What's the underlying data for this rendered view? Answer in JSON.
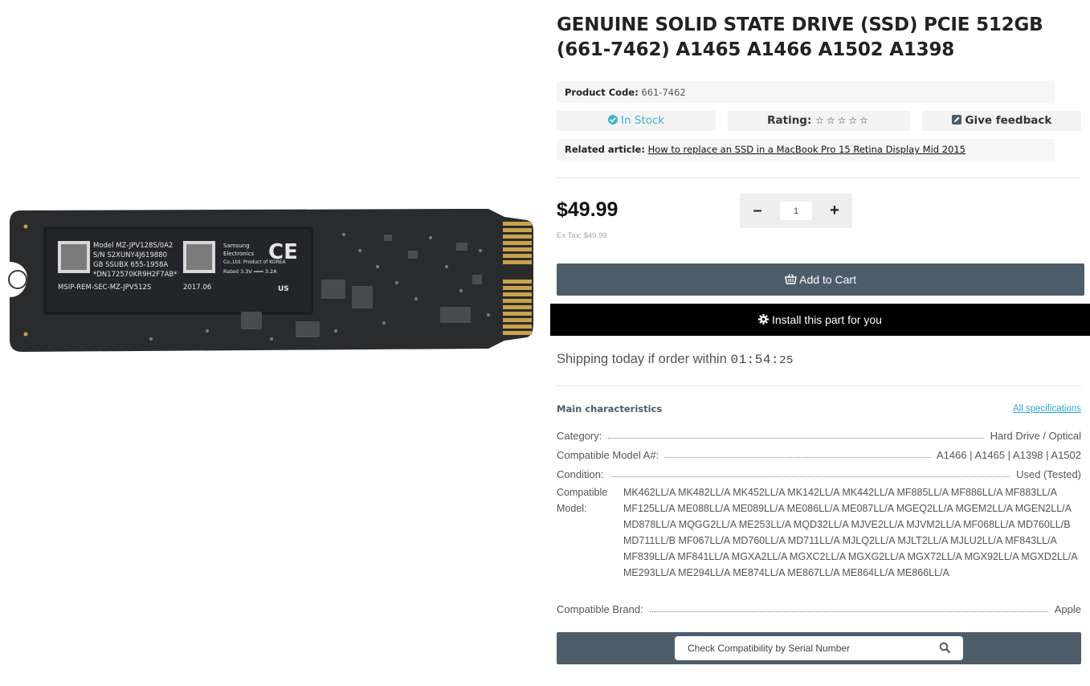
{
  "product": {
    "title": "GENUINE SOLID STATE DRIVE (SSD) PCIE 512GB (661-7462) A1465 A1466 A1502 A1398",
    "code_label": "Product Code:",
    "code_value": "661-7462",
    "stock": "In Stock",
    "rating_label": "Rating:",
    "rating_stars": "☆☆☆☆☆",
    "feedback": "Give feedback",
    "related_label": "Related article:",
    "related_link": "How to replace an SSD in a MacBook Pro 15 Retina Display Mid 2015",
    "price": "$49.99",
    "ex_tax": "Ex Tax: $49.99",
    "qty": "1",
    "qty_minus": "–",
    "qty_plus": "+",
    "add_to_cart": "Add to Cart",
    "install": "Install this part for you",
    "shipping_text": "Shipping today if order within ",
    "timer_h": "01",
    "timer_m": "54",
    "timer_s": "25",
    "timer_sep": ":"
  },
  "image_label": {
    "model": "Model  MZ-JPV128S/0A2",
    "sn": "S/N  S2XUNY4J619880",
    "gb": "GB SSUBX   655-1958A",
    "dn": "*DN172570KR9H2F7AB*",
    "msip": "MSIP-REM-SEC-MZ-JPV512S",
    "date": "2017.06",
    "maker1": "Samsung",
    "maker2": "Electronics",
    "maker3": "Co.,Ltd. Product of KOREA",
    "rated": "Rated 3.3V ═══ 3.2A",
    "ce": "CE",
    "us": "US"
  },
  "specs": {
    "heading": "Main characteristics",
    "all_link": "All specifications",
    "category_k": "Category:",
    "category_v": "Hard Drive / Optical",
    "model_num_k": "Compatible Model A#:",
    "model_num_v": "A1466 | A1465 | A1398 | A1502",
    "condition_k": "Condition:",
    "condition_v": "Used (Tested)",
    "compat_model_k": "Compatible Model:",
    "compat_model_v": "MK462LL/A MK482LL/A MK452LL/A MK142LL/A MK442LL/A MF885LL/A MF886LL/A MF883LL/A MF125LL/A ME088LL/A ME089LL/A ME086LL/A ME087LL/A MGEQ2LL/A MGEM2LL/A MGEN2LL/A MD878LL/A MQGG2LL/A ME253LL/A MQD32LL/A MJVE2LL/A MJVM2LL/A MF068LL/A MD760LL/B MD711LL/B MF067LL/A MD760LL/A MD711LL/A MJLQ2LL/A MJLT2LL/A MJLU2LL/A MF843LL/A MF839LL/A MF841LL/A MGXA2LL/A MGXC2LL/A MGXG2LL/A MGX72LL/A MGX92LL/A MGXD2LL/A ME293LL/A ME294LL/A ME874LL/A ME867LL/A ME864LL/A ME866LL/A",
    "brand_k": "Compatible Brand:",
    "brand_v": "Apple"
  },
  "check": {
    "placeholder": "Check Compatibility by Serial Number"
  },
  "colors": {
    "accent_dark": "#4d5c69",
    "stock_teal": "#3fb6c9",
    "link_blue": "#29a6d9",
    "install_black": "#000000"
  },
  "icons": [
    "check-circle-icon",
    "edit-icon",
    "basket-icon",
    "gear-icon",
    "search-icon"
  ]
}
